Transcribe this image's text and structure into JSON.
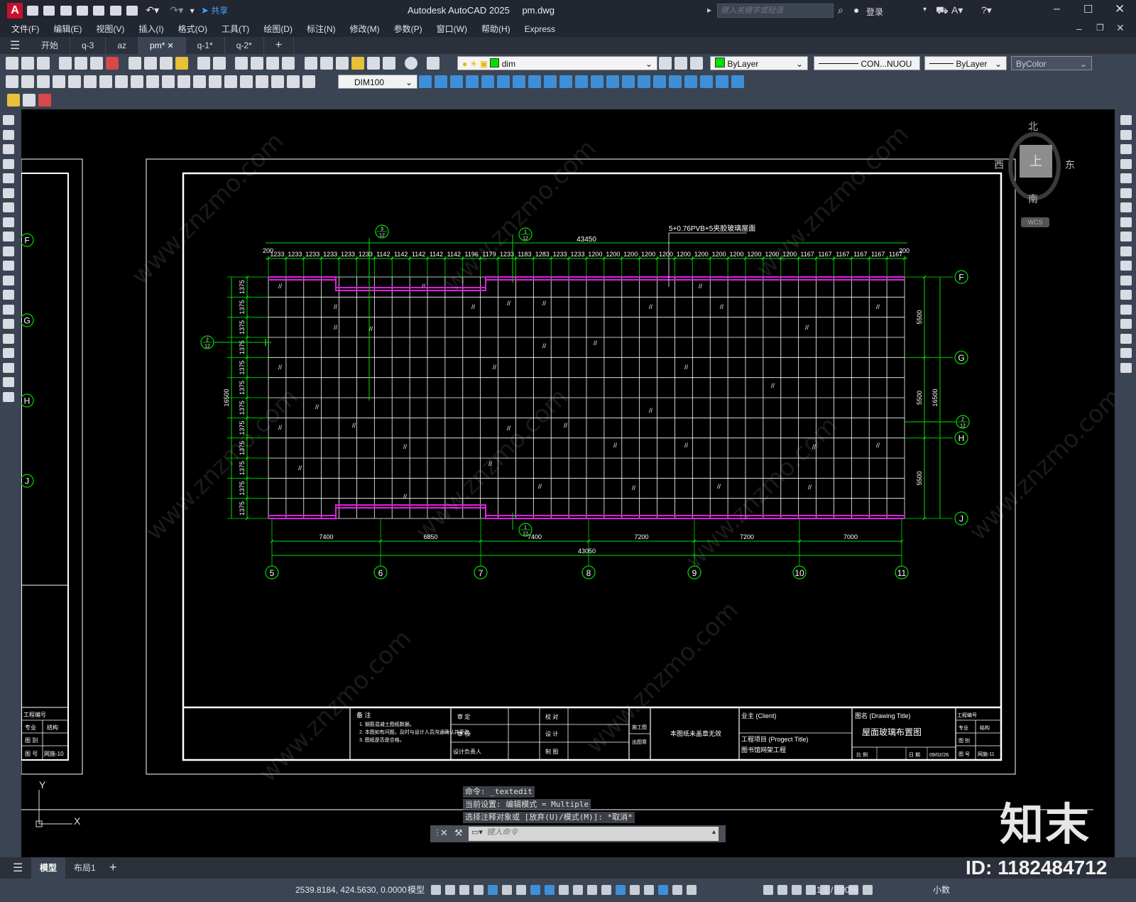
{
  "app": {
    "title": "Autodesk AutoCAD 2025",
    "filename": "pm.dwg",
    "search_placeholder": "键入关键字或短语",
    "login": "登录",
    "share": "共享",
    "logo": "A"
  },
  "menu": [
    "文件(F)",
    "编辑(E)",
    "视图(V)",
    "插入(I)",
    "格式(O)",
    "工具(T)",
    "绘图(D)",
    "标注(N)",
    "修改(M)",
    "参数(P)",
    "窗口(W)",
    "帮助(H)",
    "Express"
  ],
  "doc_tabs": [
    "开始",
    "q-3",
    "az",
    "pm*",
    "q-1*",
    "q-2*"
  ],
  "active_tab": "pm*",
  "toolbar": {
    "layer": "dim",
    "color": "ByLayer",
    "linetype": "CON...NUOU",
    "lineweight": "ByLayer",
    "plotstyle": "ByColor",
    "dimstyle": "DIM100"
  },
  "viewcube": {
    "north": "北",
    "south": "南",
    "east": "东",
    "west": "西",
    "top": "上",
    "wcs": "WCS"
  },
  "drawing": {
    "note_glass": "5+0.76PVB+5夹胶玻璃屋面",
    "top_total": "43450",
    "bottom_total": "43050",
    "edge_dim": "200",
    "top_dims": [
      "1233",
      "1233",
      "1233",
      "1233",
      "1233",
      "1233",
      "1142",
      "1142",
      "1142",
      "1142",
      "1142",
      "1196",
      "1179",
      "1233",
      "1183",
      "1283",
      "1233",
      "1233",
      "1200",
      "1200",
      "1200",
      "1200",
      "1200",
      "1200",
      "1200",
      "1200",
      "1200",
      "1200",
      "1200",
      "1200",
      "1167",
      "1167",
      "1167",
      "1167",
      "1167",
      "1167"
    ],
    "left_dims": [
      "1375",
      "1375",
      "1375",
      "1375",
      "1375",
      "1375",
      "1375",
      "1375",
      "1375",
      "1375",
      "1375",
      "1375"
    ],
    "left_total": "16500",
    "right_dims": [
      "5500",
      "5500",
      "5500"
    ],
    "right_total": "16500",
    "bottom_dims": [
      "7400",
      "6850",
      "7400",
      "7200",
      "7200",
      "7000"
    ],
    "col_axes": [
      "5",
      "6",
      "7",
      "8",
      "9",
      "10",
      "11"
    ],
    "row_axes": [
      "F",
      "G",
      "H",
      "J"
    ],
    "sec_mark": {
      "num": "2",
      "den": "12"
    },
    "sec_mark_top1": {
      "num": "3",
      "den": "12"
    },
    "sec_mark_top2": {
      "num": "1",
      "den": "12"
    },
    "sec_mark_bottom": {
      "num": "1",
      "den": "12"
    },
    "left_axes": [
      "F",
      "G",
      "H",
      "J"
    ],
    "left_tb": {
      "code_label": "工程编号",
      "major": "专业",
      "major_val": "结构",
      "cat": "图 别",
      "sheet": "图 号",
      "sheet_val": "网施-10"
    }
  },
  "titleblock": {
    "notes_title": "备 注",
    "notes": [
      "1. 钢筋混凝土图纸数据。",
      "2. 本图如有问题，及时与设计人员沟通确认并更改。",
      "3. 图纸是否是合格。"
    ],
    "review": "审 定",
    "audit": "审 核",
    "designer": "设计负责人",
    "check": "校 对",
    "design": "设 计",
    "draw": "制 图",
    "stage1": "施工图",
    "stage2": "出图章",
    "stamp_note": "本图纸未盖章无效",
    "client": "业主 (Client)",
    "project_label": "工程项目 (Progect Title)",
    "project": "图书馆网架工程",
    "dwg_title_label": "图名 (Drawing Title)",
    "dwg_title": "屋面玻璃布置图",
    "scale": "比 例",
    "date_label": "日 期",
    "date": "09/02/26",
    "code_label": "工程编号",
    "major": "专业",
    "major_val": "结构",
    "cat": "图 别",
    "sheet": "图 号",
    "sheet_val": "网施-11"
  },
  "command": {
    "history": [
      "命令: _textedit",
      "当前设置: 编辑模式 = Multiple",
      "选择注释对象或 [放弃(U)/模式(M)]: *取消*"
    ],
    "placeholder": "键入命令"
  },
  "layout_tabs": [
    "模型",
    "布局1"
  ],
  "status": {
    "coords": "2539.8184, 424.5630, 0.0000",
    "model": "模型",
    "scale": "1:1 / 100%",
    "units": "小数"
  },
  "watermark": {
    "brand": "知末",
    "id": "ID: 1182484712",
    "site": "www.znzmo.com"
  },
  "ucs": {
    "x": "X",
    "y": "Y"
  },
  "colors": {
    "grid": "#ffffff",
    "dim": "#00e000",
    "beam": "#e020e0",
    "frame": "#ffffff",
    "canvas": "#000000"
  }
}
